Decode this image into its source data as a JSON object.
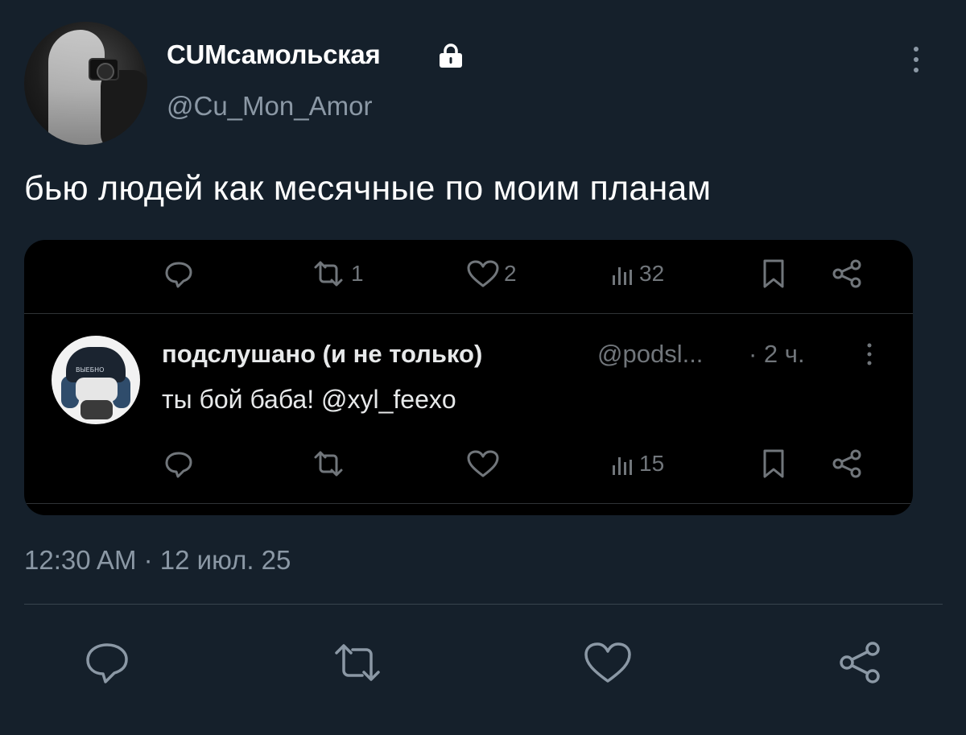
{
  "author": {
    "display_name": "CUMсамольская",
    "handle": "@Cu_Mon_Amor",
    "protected_icon": "lock-icon"
  },
  "tweet": {
    "text": "бью людей как месячные по моим планам",
    "timestamp": "12:30 AM · 12 июл. 25"
  },
  "embedded": {
    "top_actions": {
      "reply_count": "",
      "retweet_count": "1",
      "like_count": "2",
      "views_count": "32"
    },
    "reply": {
      "name": "подслушано (и не только)",
      "handle": "@podsl...",
      "time": "· 2 ч.",
      "text": "ты бой баба! @xyl_feexo",
      "avatar_text": "ВЫЕБНО",
      "actions": {
        "views_count": "15"
      }
    }
  },
  "icons": {
    "reply": "reply-icon",
    "retweet": "retweet-icon",
    "like": "heart-icon",
    "views": "views-icon",
    "bookmark": "bookmark-icon",
    "share": "share-icon",
    "more": "more-icon"
  },
  "colors": {
    "background": "#15202b",
    "card_background": "#000000",
    "secondary_text": "#8b98a5",
    "divider": "#38444d"
  }
}
